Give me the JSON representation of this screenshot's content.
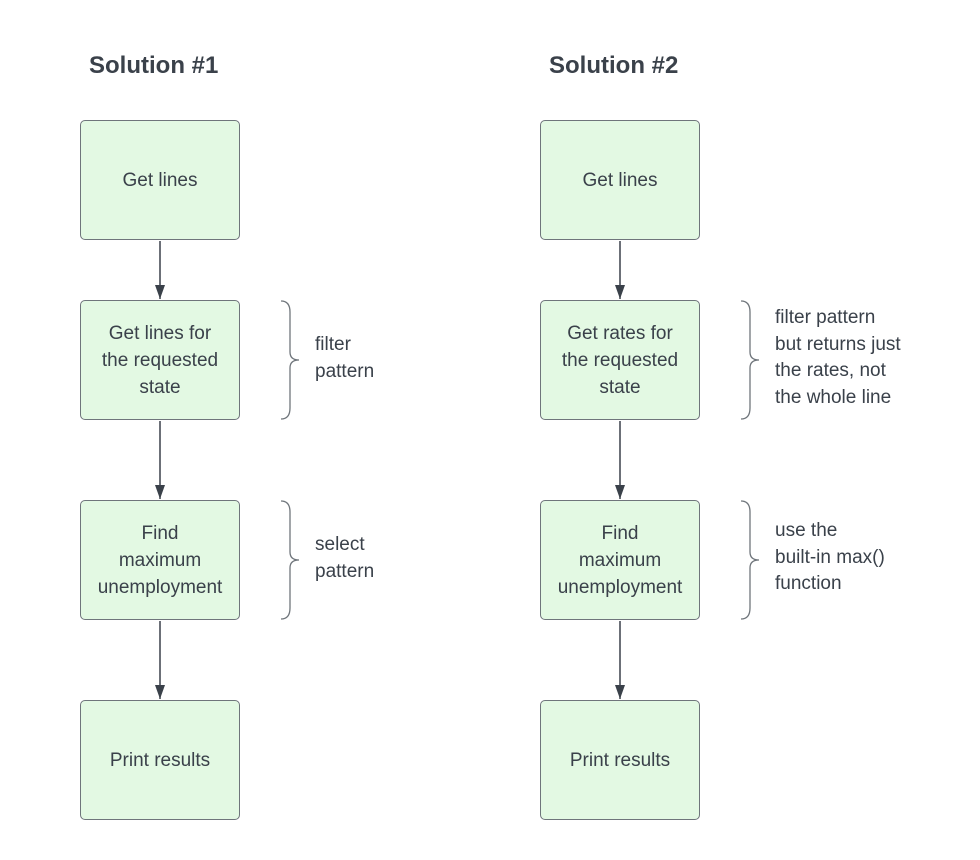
{
  "solutions": [
    {
      "title": "Solution #1",
      "steps": [
        "Get lines",
        "Get lines for\nthe requested\nstate",
        "Find\nmaximum\nunemployment",
        "Print results"
      ],
      "notes": [
        {
          "step": 1,
          "text": "filter\npattern"
        },
        {
          "step": 2,
          "text": "select\npattern"
        }
      ]
    },
    {
      "title": "Solution #2",
      "steps": [
        "Get lines",
        "Get rates for\nthe requested\nstate",
        "Find\nmaximum\nunemployment",
        "Print results"
      ],
      "notes": [
        {
          "step": 1,
          "text": "filter pattern\nbut returns just\nthe rates, not\nthe whole line"
        },
        {
          "step": 2,
          "text": "use the\nbuilt-in max()\nfunction"
        }
      ]
    }
  ],
  "colors": {
    "box_fill": "#e3f9e3",
    "box_border": "#6f757b",
    "text": "#3a414a",
    "arrow": "#3a414a"
  }
}
